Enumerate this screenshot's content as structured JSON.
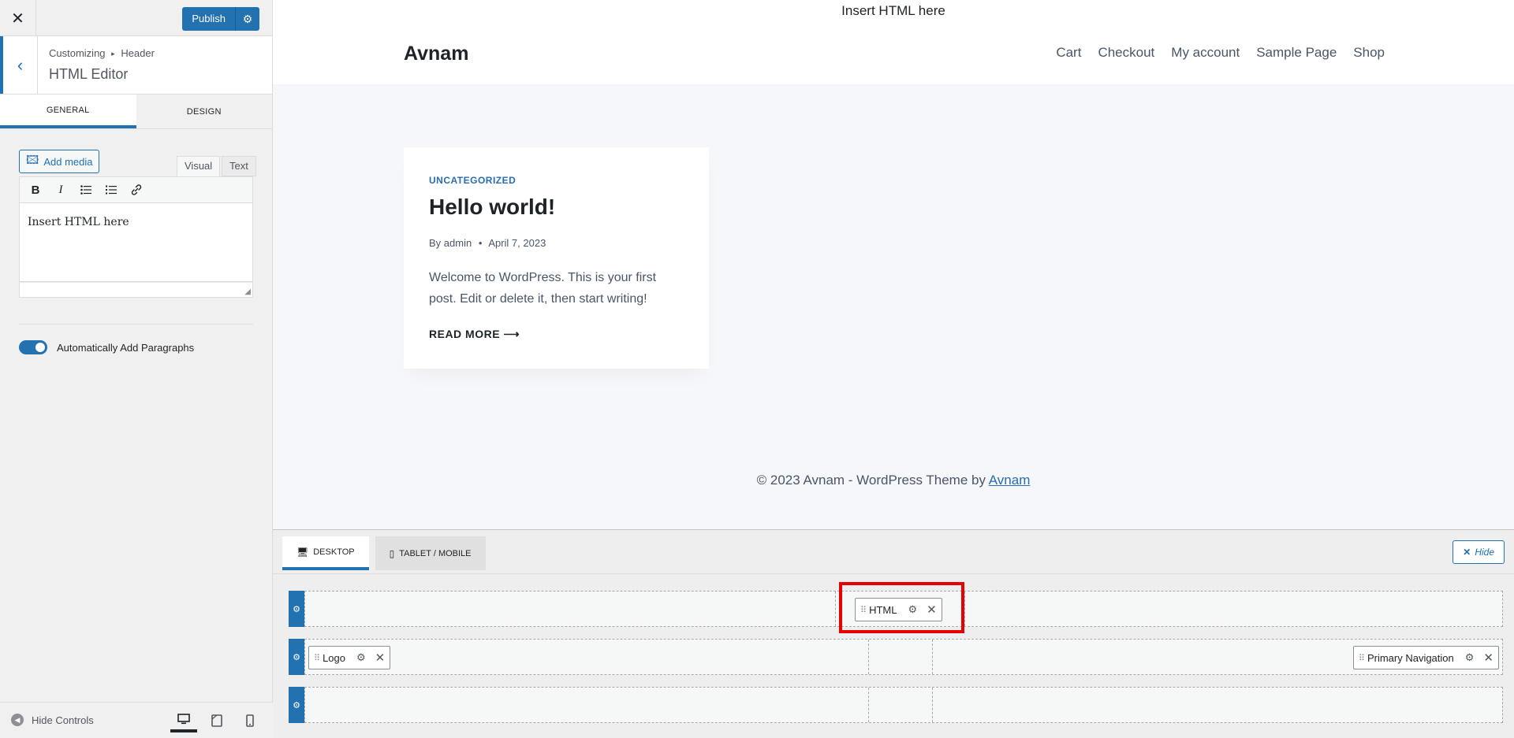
{
  "panel": {
    "close_icon": "✕",
    "publish_label": "Publish",
    "breadcrumb_root": "Customizing",
    "breadcrumb_separator": "▸",
    "breadcrumb_leaf": "Header",
    "section_title": "HTML Editor",
    "tabs": [
      {
        "label": "GENERAL",
        "active": true
      },
      {
        "label": "DESIGN",
        "active": false
      }
    ],
    "editor": {
      "add_media_label": "Add media",
      "visual_tab": "Visual",
      "text_tab": "Text",
      "toolbar_icons": [
        "bold-icon",
        "italic-icon",
        "bullet-list-icon",
        "numbered-list-icon",
        "link-icon"
      ],
      "content": "Insert HTML here"
    },
    "toggle_label": "Automatically Add Paragraphs",
    "toggle_on": true,
    "hide_controls_label": "Hide Controls"
  },
  "preview": {
    "top_html": "Insert HTML here",
    "site_title": "Avnam",
    "nav": [
      "Cart",
      "Checkout",
      "My account",
      "Sample Page",
      "Shop"
    ],
    "post": {
      "category": "UNCATEGORIZED",
      "title": "Hello world!",
      "author_prefix": "By",
      "author": "admin",
      "meta_sep": "•",
      "date": "April 7, 2023",
      "excerpt": "Welcome to WordPress. This is your first post. Edit or delete it, then start writing!",
      "read_more": "READ MORE"
    },
    "footer_prefix": "© 2023 Avnam - WordPress Theme by",
    "footer_link": "Avnam"
  },
  "builder": {
    "tabs": [
      {
        "label": "DESKTOP",
        "active": true
      },
      {
        "label": "TABLET / MOBILE",
        "active": false
      }
    ],
    "hide_label": "Hide",
    "items": {
      "html": "HTML",
      "logo": "Logo",
      "primary_nav": "Primary Navigation"
    }
  },
  "colors": {
    "accent": "#2271b1",
    "highlight": "#e50000"
  }
}
